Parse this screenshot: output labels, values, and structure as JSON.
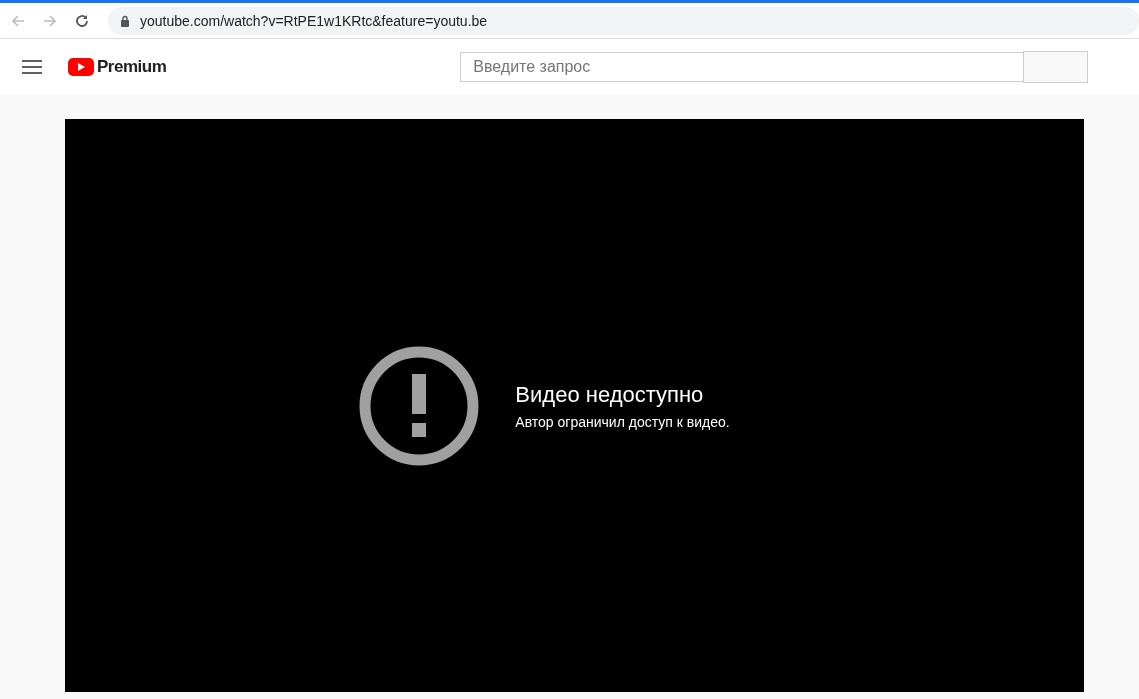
{
  "browser": {
    "url": "youtube.com/watch?v=RtPE1w1KRtc&feature=youtu.be"
  },
  "header": {
    "logo_text": "Premium",
    "search": {
      "placeholder": "Введите запрос"
    }
  },
  "player": {
    "error_title": "Видео недоступно",
    "error_message": "Автор ограничил доступ к видео."
  }
}
